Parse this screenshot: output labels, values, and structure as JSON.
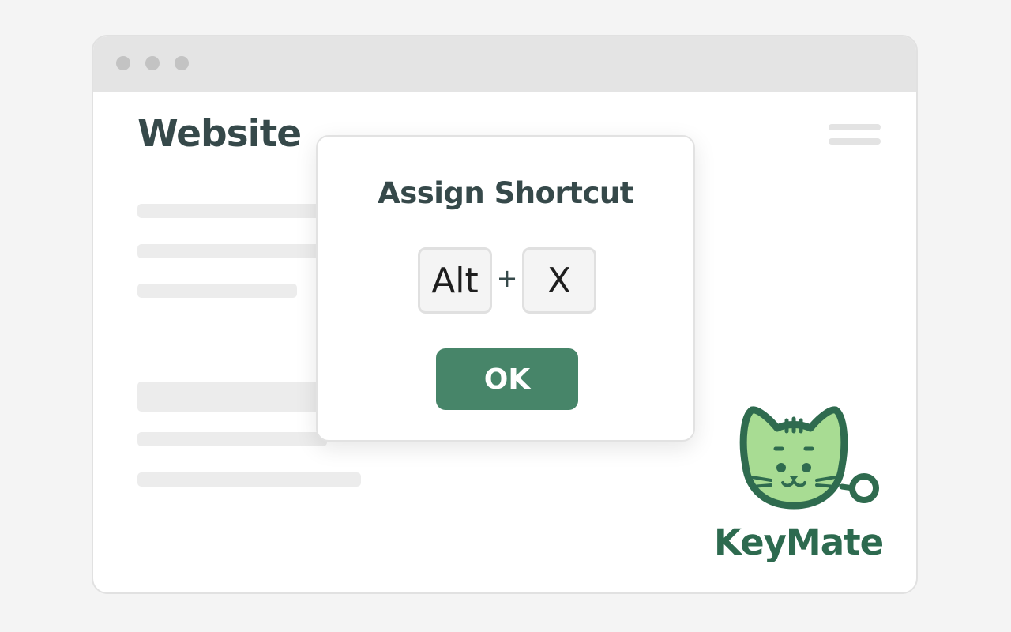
{
  "site": {
    "title": "Website"
  },
  "dialog": {
    "title": "Assign Shortcut",
    "keys": [
      "Alt",
      "X"
    ],
    "separator": "+",
    "ok_label": "OK"
  },
  "brand": {
    "name": "KeyMate",
    "logo_icon": "cat-keychain-icon"
  },
  "colors": {
    "accent": "#478569",
    "brand_text": "#2d6a4f",
    "title_text": "#36494a",
    "logo_fill": "#a8dc93",
    "logo_outline": "#2f6b4f"
  }
}
